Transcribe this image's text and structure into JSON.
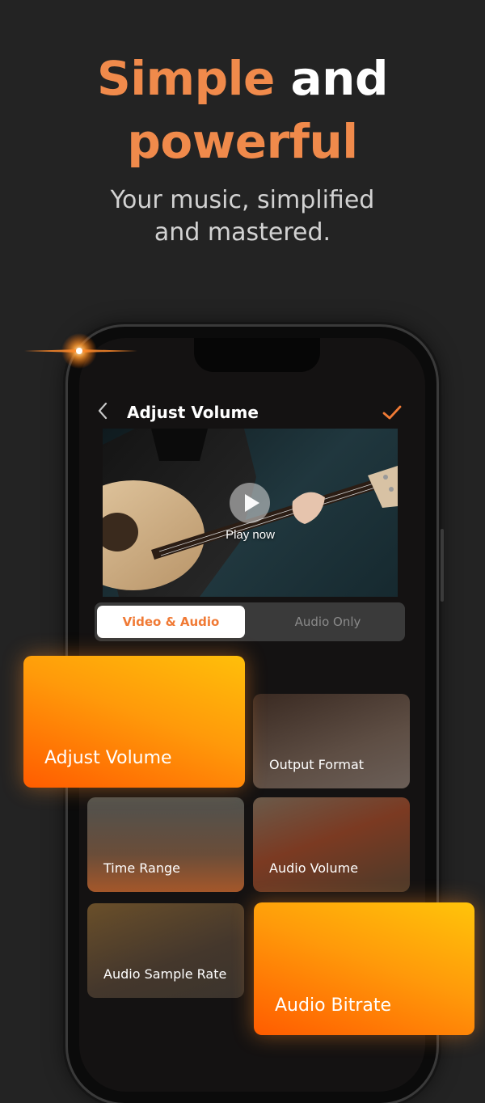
{
  "headline": {
    "accent_word": "Simple",
    "word_2": "and",
    "word_3": "powerful"
  },
  "subtitle": {
    "line1": "Your music, simplified",
    "line2": "and mastered."
  },
  "app": {
    "nav_title": "Adjust Volume",
    "play_label": "Play now",
    "tabs": [
      {
        "label": "Video & Audio",
        "active": true
      },
      {
        "label": "Audio Only",
        "active": false
      }
    ],
    "features": [
      {
        "label": "Output Format"
      },
      {
        "label": "Time Range"
      },
      {
        "label": "Audio Volume"
      },
      {
        "label": "Audio Sample Rate"
      }
    ]
  },
  "highlight_cards": [
    {
      "label": "Adjust Volume"
    },
    {
      "label": "Audio Bitrate"
    }
  ],
  "colors": {
    "accent": "#f08a4b",
    "background": "#232323",
    "card_gradient_start": "#ff5a00",
    "card_gradient_end": "#ffbe0b"
  },
  "icons": [
    "back-chevron-icon",
    "checkmark-icon",
    "play-icon",
    "sparkle-flare"
  ]
}
